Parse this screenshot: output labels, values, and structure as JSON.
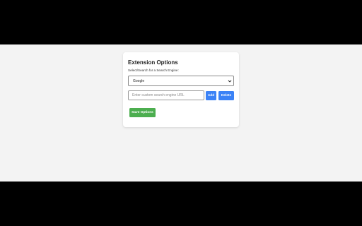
{
  "options": {
    "title": "Extension Options",
    "select_label": "Select/Search for a Search Engine:",
    "selected_engine": "Google",
    "custom_url_placeholder": "Enter custom search engine URL",
    "add_label": "Add",
    "delete_label": "Delete",
    "save_label": "Save Options"
  },
  "colors": {
    "primary_button": "#3b82f6",
    "save_button": "#4cae4f",
    "page_background": "#f3f3f3",
    "letterbox": "#000000"
  },
  "icons": {
    "select_arrow": "chevron-down-icon"
  }
}
